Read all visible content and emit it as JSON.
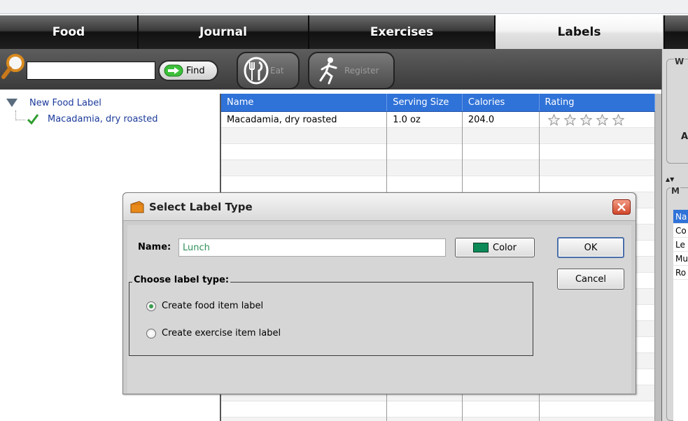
{
  "tabs": [
    {
      "label": "Food",
      "active": false
    },
    {
      "label": "Journal",
      "active": false
    },
    {
      "label": "Exercises",
      "active": false
    },
    {
      "label": "Labels",
      "active": true
    }
  ],
  "toolbar": {
    "search_value": "",
    "find_label": "Find",
    "eat_label": "Eat",
    "register_label": "Register"
  },
  "tree": {
    "root": "New Food Label",
    "child": "Macadamia, dry roasted"
  },
  "table": {
    "columns": [
      "Name",
      "Serving Size",
      "Calories",
      "Rating"
    ],
    "rows": [
      {
        "name": "Macadamia, dry roasted",
        "serving": "1.0 oz",
        "calories": "204.0",
        "rating": 0,
        "rating_max": 5
      }
    ]
  },
  "right_panel": {
    "box1_title": "W",
    "box1_letter": "A",
    "box2_title": "M",
    "list": [
      "Na",
      "Co",
      "Le",
      "Mu",
      "Ro"
    ]
  },
  "dialog": {
    "title": "Select Label Type",
    "name_label": "Name:",
    "name_value": "Lunch",
    "color_label": "Color",
    "color_value": "#0b8a58",
    "ok_label": "OK",
    "cancel_label": "Cancel",
    "group_title": "Choose label type:",
    "options": [
      {
        "label": "Create food item label",
        "selected": true
      },
      {
        "label": "Create exercise item label",
        "selected": false
      }
    ]
  },
  "colors": {
    "header_blue": "#2f72d8",
    "accent_green": "#3a9c4f"
  }
}
